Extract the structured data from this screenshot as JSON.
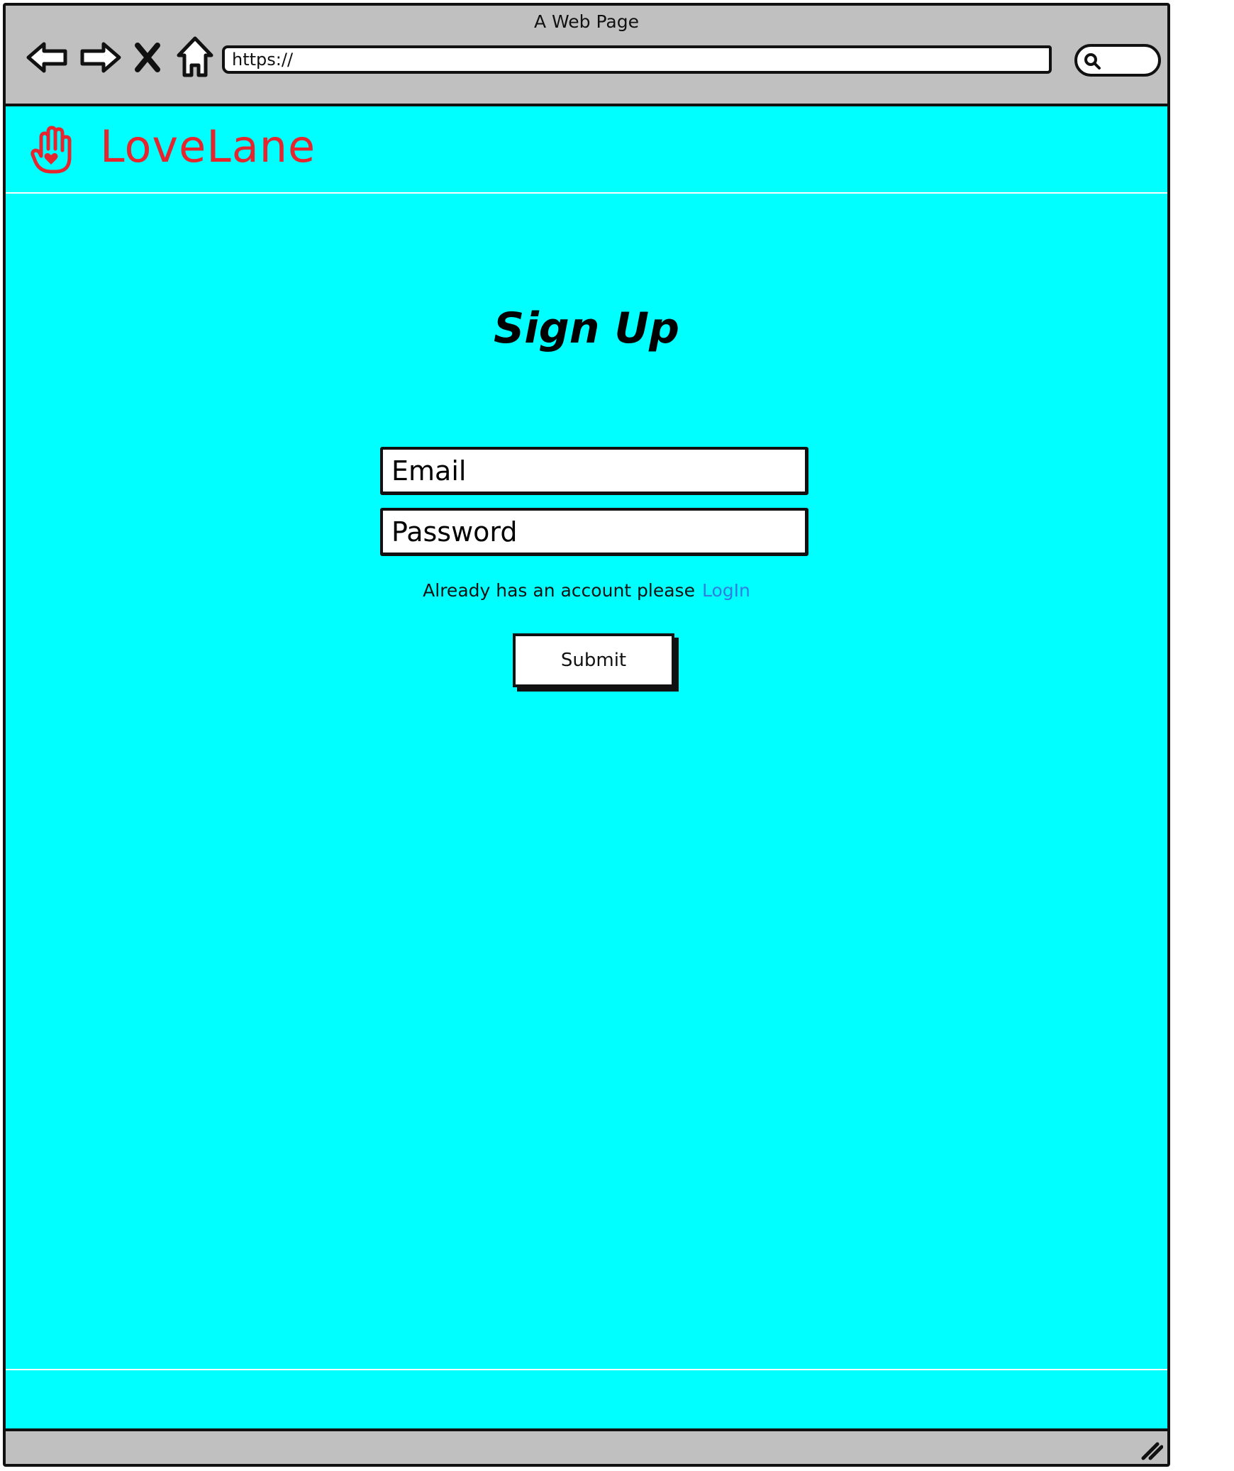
{
  "window": {
    "title": "A Web Page"
  },
  "toolbar": {
    "icons": [
      "back-arrow-icon",
      "forward-arrow-icon",
      "stop-icon",
      "home-icon"
    ],
    "url_value": "https://",
    "search_icon": "search-icon"
  },
  "header": {
    "logo_icon": "raised-hand-heart-icon",
    "brand_name": "LoveLane"
  },
  "form": {
    "title": "Sign Up",
    "email_placeholder": "Email",
    "password_placeholder": "Password",
    "helper_text": "Already has an account please",
    "login_link": "LogIn",
    "submit_label": "Submit"
  },
  "colors": {
    "page_background": "#00ffff",
    "chrome": "#c0c0c0",
    "brand": "#e5262f",
    "link": "#2f7fe0"
  }
}
